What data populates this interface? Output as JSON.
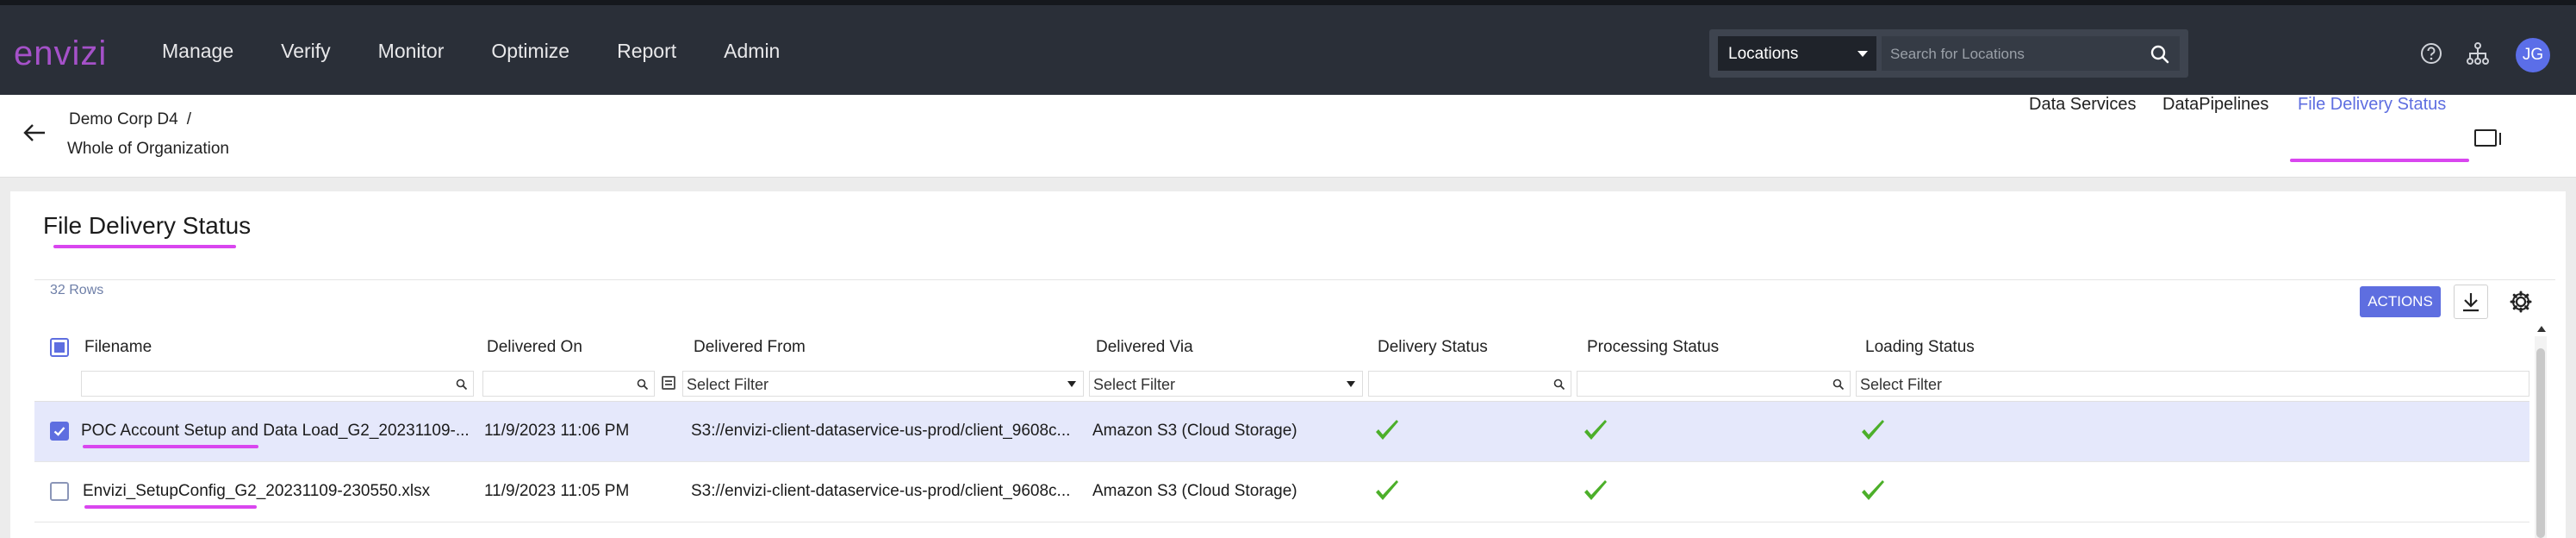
{
  "app": {
    "logo": "envizi",
    "nav": [
      "Manage",
      "Verify",
      "Monitor",
      "Optimize",
      "Report",
      "Admin"
    ],
    "location_select": "Locations",
    "search_placeholder": "Search for Locations",
    "user_initials": "JG"
  },
  "breadcrumb": {
    "org": "Demo Corp D4",
    "separator": "/",
    "scope": "Whole of Organization"
  },
  "tabs": [
    {
      "label": "Data Services",
      "active": false
    },
    {
      "label": "DataPipelines",
      "active": false
    },
    {
      "label": "File Delivery Status",
      "active": true
    }
  ],
  "page": {
    "title": "File Delivery Status",
    "rows_count": "32 Rows",
    "actions_label": "ACTIONS"
  },
  "grid": {
    "columns": [
      "Filename",
      "Delivered On",
      "Delivered From",
      "Delivered Via",
      "Delivery Status",
      "Processing Status",
      "Loading Status"
    ],
    "filter_placeholders": {
      "delivered_from": "Select Filter",
      "delivered_via": "Select Filter",
      "loading_status": "Select Filter"
    },
    "rows": [
      {
        "selected": true,
        "filename": "POC Account Setup and Data Load_G2_20231109-...",
        "delivered_on": "11/9/2023 11:06 PM",
        "delivered_from": "S3://envizi-client-dataservice-us-prod/client_9608c...",
        "delivered_via": "Amazon S3 (Cloud Storage)",
        "delivery_status": "success",
        "processing_status": "success",
        "loading_status": "success"
      },
      {
        "selected": false,
        "filename": "Envizi_SetupConfig_G2_20231109-230550.xlsx",
        "delivered_on": "11/9/2023 11:05 PM",
        "delivered_from": "S3://envizi-client-dataservice-us-prod/client_9608c...",
        "delivered_via": "Amazon S3 (Cloud Storage)",
        "delivery_status": "success",
        "processing_status": "success",
        "loading_status": "success"
      }
    ]
  },
  "colors": {
    "accent": "#5e6ee0",
    "highlight": "#d946ef",
    "success": "#4caf2a",
    "topbar": "#2a2f38"
  }
}
